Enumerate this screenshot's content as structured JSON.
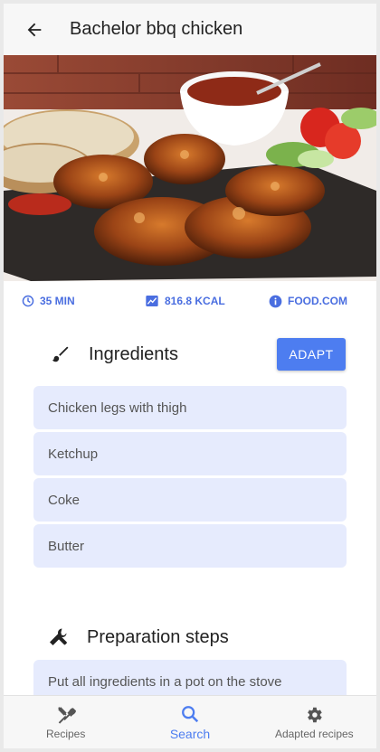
{
  "appbar": {
    "title": "Bachelor bbq chicken",
    "back_icon": "arrow-left-icon"
  },
  "hero": {
    "alt": ""
  },
  "meta": {
    "time": "35 MIN",
    "calories": "816.8 KCAL",
    "source": "FOOD.COM",
    "accent": "#4a6ee0"
  },
  "ingredients": {
    "title": "Ingredients",
    "adapt_label": "ADAPT",
    "items": [
      "Chicken legs with thigh",
      "Ketchup",
      "Coke",
      "Butter"
    ]
  },
  "preparation": {
    "title": "Preparation steps",
    "steps": [
      "Put all ingredients in a pot on the stove"
    ]
  },
  "nav": {
    "items": [
      {
        "label": "Recipes",
        "icon": "cutlery-icon"
      },
      {
        "label": "Search",
        "icon": "search-icon",
        "active": true
      },
      {
        "label": "Adapted recipes",
        "icon": "gear-icon"
      }
    ],
    "active_color": "#4d7df0"
  }
}
